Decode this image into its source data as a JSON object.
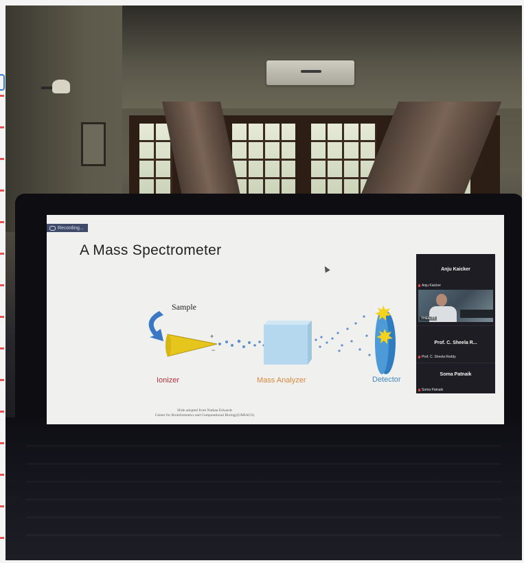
{
  "recording": {
    "label": "Recording..."
  },
  "slide": {
    "title": "A Mass Spectrometer",
    "sample_label": "Sample",
    "ionizer_label": "Ionizer",
    "analyzer_label": "Mass Analyzer",
    "detector_label": "Detector",
    "credit_line1": "Slide adopted from Nathan Edwards",
    "credit_line2": "Center for Bioinformatics and Computational Biology(UMIACS)",
    "colors": {
      "ionizer": "#b3313a",
      "analyzer": "#d8883a",
      "detector": "#3f86c0"
    }
  },
  "participants": {
    "items": [
      {
        "name": "Anju Kaicker",
        "tag": "Anju Kaicker"
      },
      {
        "video_label": "THEE.TT"
      },
      {
        "name": "Prof. C. Sheela R...",
        "tag": "Prof. C. Sheela Reddy"
      },
      {
        "name": "Soma Patnaik",
        "tag": "Soma Patnaik"
      }
    ]
  }
}
